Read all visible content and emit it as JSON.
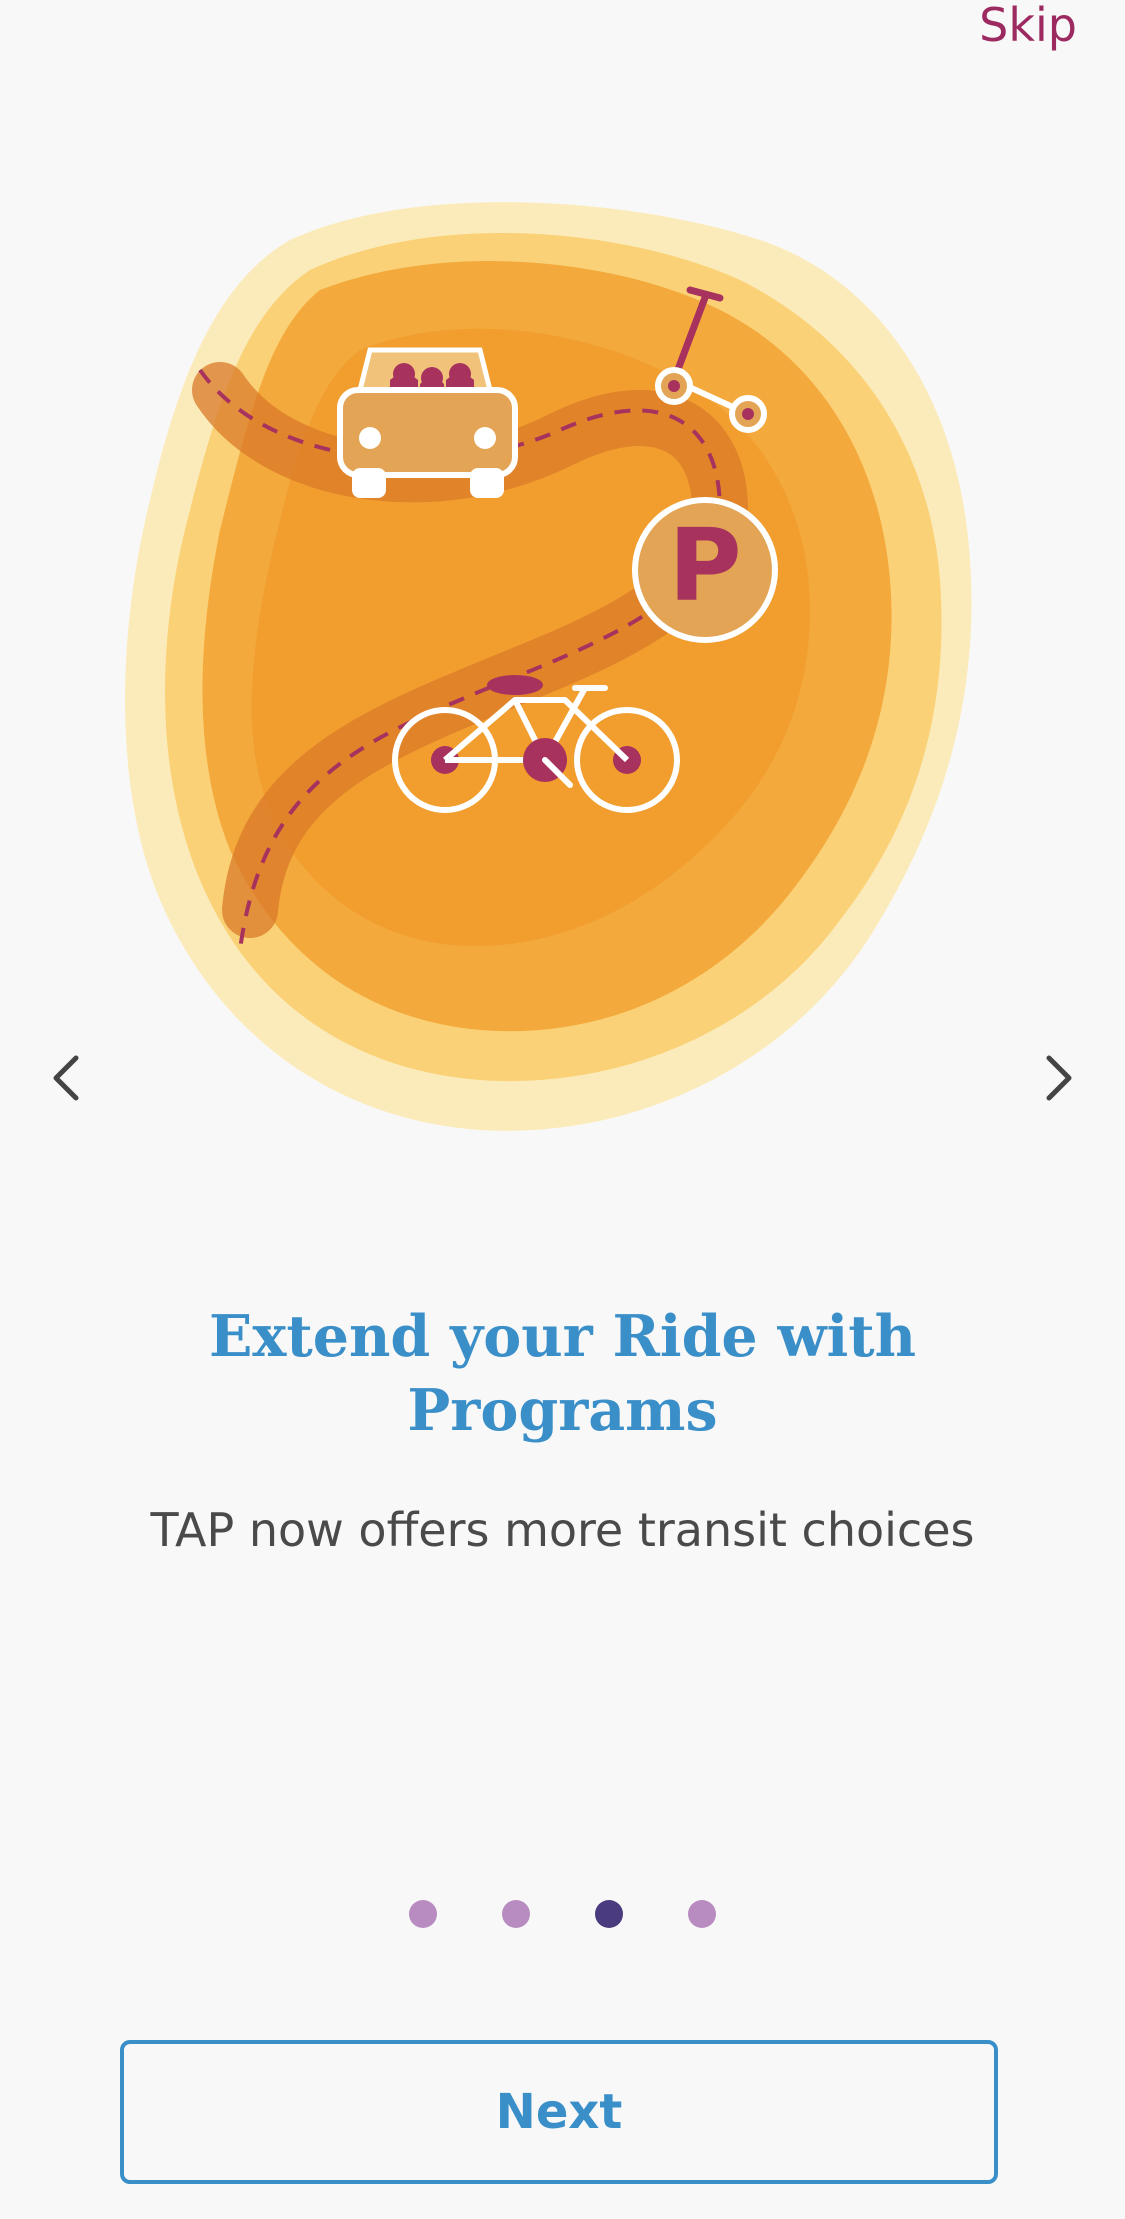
{
  "header": {
    "skip_label": "Skip"
  },
  "slide": {
    "title": "Extend your Ride with Programs",
    "subtitle": "TAP now offers more transit choices",
    "illustration_icons": [
      "car-icon",
      "scooter-icon",
      "parking-icon",
      "bicycle-icon"
    ],
    "parking_letter": "P"
  },
  "pager": {
    "total": 4,
    "active_index": 2
  },
  "footer": {
    "next_label": "Next"
  },
  "colors": {
    "accent_blue": "#3a8fc8",
    "brand_maroon": "#9c2a60",
    "orange": "#f0a030",
    "dot_inactive": "#b88cc0",
    "dot_active": "#4a3a7e"
  }
}
